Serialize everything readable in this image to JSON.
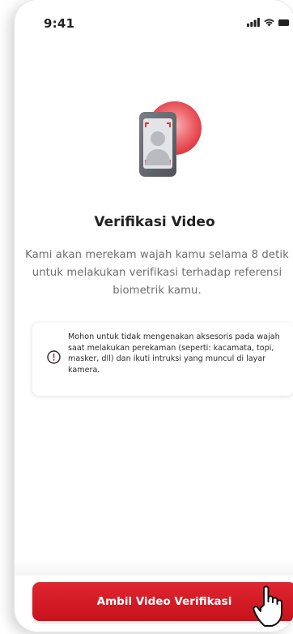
{
  "status_bar": {
    "time": "9:41",
    "icons": [
      "signal-icon",
      "wifi-icon",
      "battery-icon"
    ]
  },
  "illustration": {
    "icon": "face-verification-illustration",
    "colors": {
      "accent": "#e0343c",
      "phone_body": "#6b6f75",
      "screen": "#e3e4e7"
    }
  },
  "title": "Verifikasi Video",
  "description": "Kami akan merekam wajah kamu selama 8 detik untuk melakukan verifikasi terhadap referensi biometrik kamu.",
  "notice": {
    "icon": "info-icon",
    "text": "Mohon untuk tidak mengenakan aksesoris pada wajah saat melakukan perekaman (seperti: kacamata, topi, masker, dll) dan ikuti intruksi yang muncul di layar kamera."
  },
  "cta": {
    "label": "Ambil Video Verifikasi",
    "color": "#d41c25"
  },
  "cursor": {
    "icon": "pointer-hand-icon"
  }
}
